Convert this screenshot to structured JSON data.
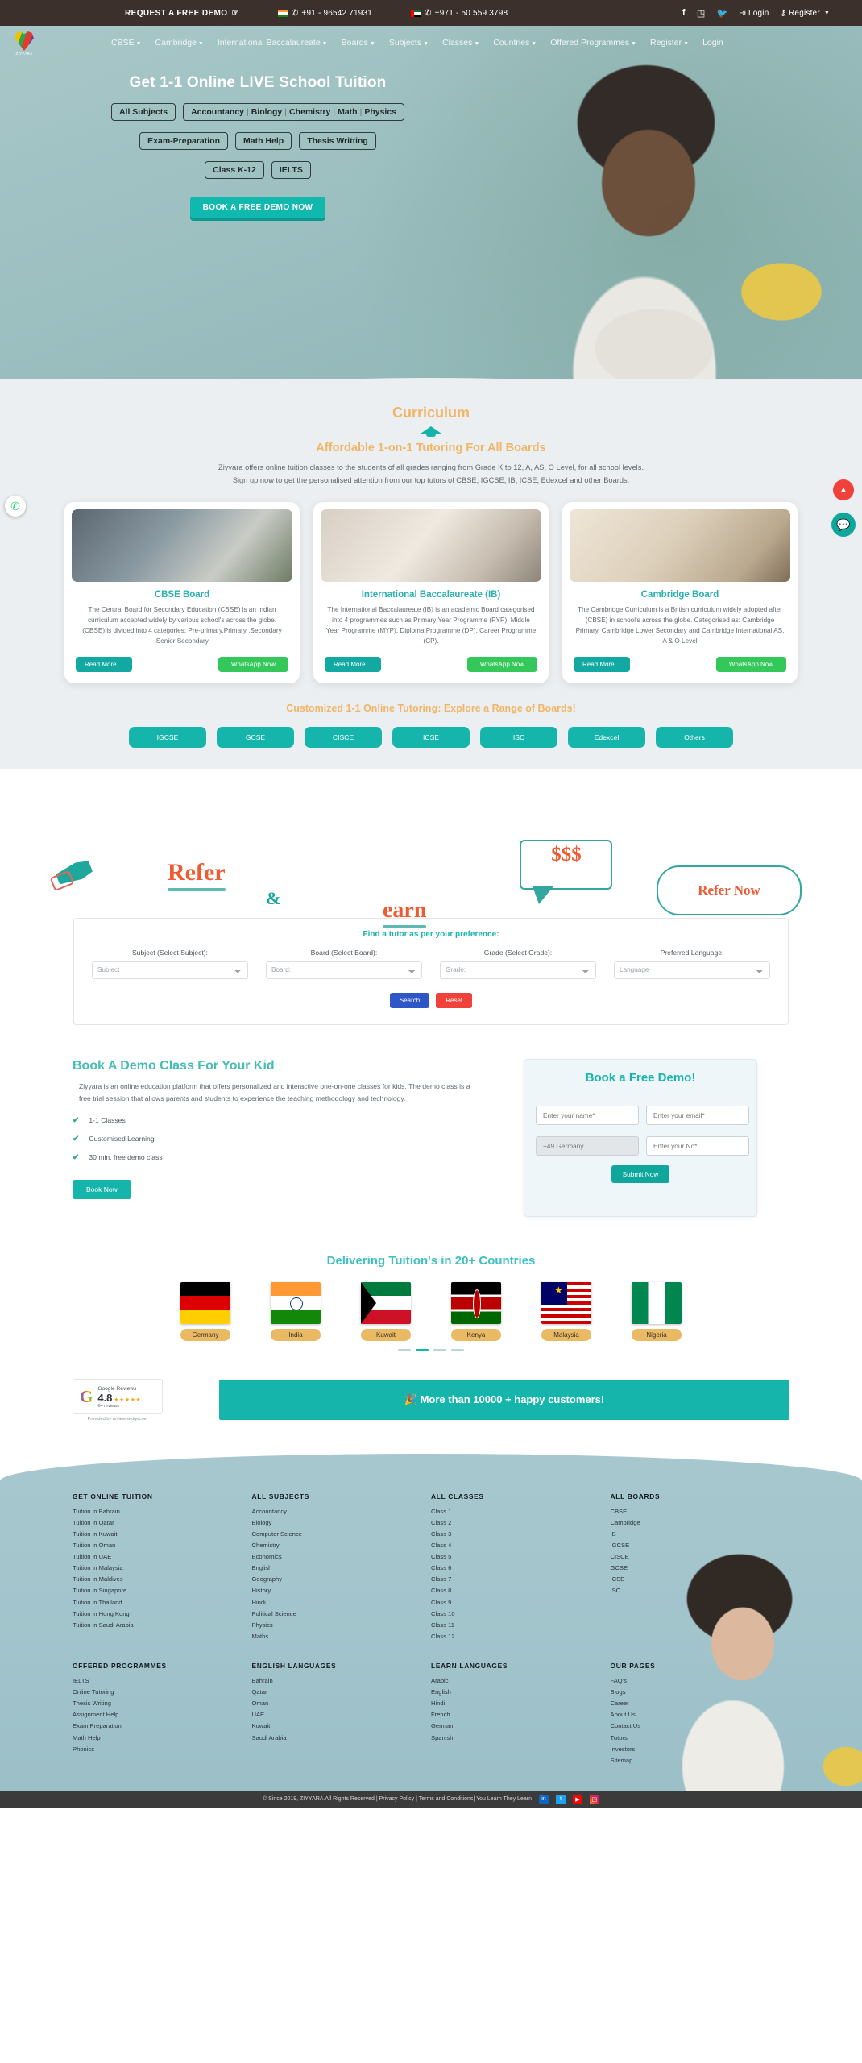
{
  "topbar": {
    "demo_label": "REQUEST A FREE DEMO",
    "phone_in": "+91 - 96542 71931",
    "phone_ae": "+971 - 50 559 3798",
    "login": "Login",
    "register": "Register",
    "icons": [
      "facebook-icon",
      "instagram-icon",
      "twitter-icon"
    ]
  },
  "nav": {
    "brand": "ZIYYARA",
    "items": [
      {
        "label": "CBSE",
        "caret": true
      },
      {
        "label": "Cambridge",
        "caret": true
      },
      {
        "label": "International Baccalaureate",
        "caret": true
      },
      {
        "label": "Boards",
        "caret": true
      },
      {
        "label": "Subjects",
        "caret": true
      },
      {
        "label": "Classes",
        "caret": true
      },
      {
        "label": "Countries",
        "caret": true
      },
      {
        "label": "Offered Programmes",
        "caret": true
      },
      {
        "label": "Register",
        "caret": true
      },
      {
        "label": "Login",
        "caret": false
      }
    ]
  },
  "hero": {
    "title": "Get 1-1 Online LIVE School Tuition",
    "pill_all": "All Subjects",
    "pill_subjects": [
      "Accountancy",
      "Biology",
      "Chemistry",
      "Math",
      "Physics"
    ],
    "pills_row2": [
      "Exam-Preparation",
      "Math Help",
      "Thesis Writting"
    ],
    "pills_row3": [
      "Class K-12",
      "IELTS"
    ],
    "cta": "BOOK A FREE DEMO NOW"
  },
  "curriculum": {
    "title": "Curriculum",
    "subtitle": "Affordable 1-on-1 Tutoring For All Boards",
    "paragraph_line1": "Ziyyara offers online tuition classes to the students of all grades ranging from Grade K to 12, A, AS, O Level, for all school levels.",
    "paragraph_line2": "Sign up now to get the personalised attention from our top tutors of CBSE, IGCSE, IB, ICSE, Edexcel and other Boards.",
    "cards": [
      {
        "title": "CBSE Board",
        "text": "The Central Board for Secondary Education (CBSE) is an Indian curriculum accepted widely by various school's across the globe. (CBSE) is divided into 4 categories: Pre-primary,Primary ,Secondary ,Senior Secondary.",
        "read_more": "Read More....",
        "whatsapp": "WhatsApp Now"
      },
      {
        "title": "International Baccalaureate (IB)",
        "text": "The International Baccalaureate (IB) is an academic Board categorised into 4 programmes such as Primary Year Programme (PYP), Middle Year Programme (MYP), Diploma Programme (DP), Career Programme (CP).",
        "read_more": "Read More....",
        "whatsapp": "WhatsApp Now"
      },
      {
        "title": "Cambridge Board",
        "text": "The Cambridge Curriculum is a British curriculum widely adopted after (CBSE) in school's across the globe. Categorised as: Cambridge Primary, Cambridge Lower Secondary and Cambridge International AS, A & O Level",
        "read_more": "Read More....",
        "whatsapp": "WhatsApp Now"
      }
    ],
    "boards_heading": "Customized 1-1 Online Tutoring: Explore a Range of Boards!",
    "board_buttons": [
      "IGCSE",
      "GCSE",
      "CISCE",
      "ICSE",
      "ISC",
      "Edexcel",
      "Others"
    ]
  },
  "refer": {
    "word1": "Refer",
    "amp": "&",
    "word2": "earn",
    "dollars": "$$$",
    "cta": "Refer Now"
  },
  "find_tutor": {
    "title": "Find a tutor as per your preference:",
    "fields": [
      {
        "label": "Subject (Select Subject):",
        "placeholder": "Subject"
      },
      {
        "label": "Board (Select Board):",
        "placeholder": "Board:"
      },
      {
        "label": "Grade (Select Grade):",
        "placeholder": "Grade:"
      },
      {
        "label": "Preferred Language:",
        "placeholder": "Language"
      }
    ],
    "search": "Search",
    "reset": "Reset"
  },
  "book_demo": {
    "title": "Book A Demo Class For Your Kid",
    "paragraph": "Ziyyara is an online education platform that offers personalized and interactive one-on-one classes for kids. The demo class is a free trial session that allows parents and students to experience the teaching methodology and technology.",
    "checks": [
      "1-1 Classes",
      "Customised Learning",
      "30 min. free demo class"
    ],
    "book_now": "Book Now",
    "card_title": "Book a Free Demo!",
    "name_placeholder": "Enter your name*",
    "email_placeholder": "Enter your email*",
    "country_code": "+49 Germany",
    "phone_placeholder": "Enter your No*",
    "submit": "Submit Now"
  },
  "countries": {
    "title": "Delivering Tuition's in 20+ Countries",
    "items": [
      {
        "name": "Germany",
        "flag": "flag-germany"
      },
      {
        "name": "India",
        "flag": "flag-india"
      },
      {
        "name": "Kuwait",
        "flag": "flag-kuwait"
      },
      {
        "name": "Kenya",
        "flag": "flag-kenya"
      },
      {
        "name": "Malaysia",
        "flag": "flag-malaysia"
      },
      {
        "name": "Nigeria",
        "flag": "flag-nigeria"
      }
    ]
  },
  "reviews": {
    "google_label": "Google Reviews",
    "score": "4.8",
    "stars": "★★★★★",
    "count": "64 reviews",
    "provided_by": "Provided by review-widget.net",
    "happy_customers": "🎉 More than 10000 + happy customers!"
  },
  "footer": {
    "columns_row1": [
      {
        "heading": "GET ONLINE TUITION",
        "links": [
          "Tuition in Bahrain",
          "Tuition in Qatar",
          "Tuition in Kuwait",
          "Tuition in Oman",
          "Tuition in UAE",
          "Tuition in Malaysia",
          "Tuition in Maldives",
          "Tuition in Singapore",
          "Tuition in Thailand",
          "Tuition in Hong Kong",
          "Tuition in Saudi Arabia"
        ]
      },
      {
        "heading": "ALL SUBJECTS",
        "links": [
          "Accountancy",
          "Biology",
          "Computer Science",
          "Chemistry",
          "Economics",
          "English",
          "Geography",
          "History",
          "Hindi",
          "Political Science",
          "Physics",
          "Maths"
        ]
      },
      {
        "heading": "ALL CLASSES",
        "links": [
          "Class 1",
          "Class 2",
          "Class 3",
          "Class 4",
          "Class 5",
          "Class 6",
          "Class 7",
          "Class 8",
          "Class 9",
          "Class 10",
          "Class 11",
          "Class 12"
        ]
      },
      {
        "heading": "ALL BOARDS",
        "links": [
          "CBSE",
          "Cambridge",
          "IB",
          "IGCSE",
          "CISCE",
          "GCSE",
          "ICSE",
          "ISC"
        ]
      }
    ],
    "columns_row2": [
      {
        "heading": "OFFERED PROGRAMMES",
        "links": [
          "IELTS",
          "Online Tutoring",
          "Thesis Writing",
          "Assignment Help",
          "Exam Preparation",
          "Math Help",
          "Phonics"
        ]
      },
      {
        "heading": "ENGLISH LANGUAGES",
        "links": [
          "Bahrain",
          "Qatar",
          "Oman",
          "UAE",
          "Kuwait",
          "Saudi Arabia"
        ]
      },
      {
        "heading": "LEARN LANGUAGES",
        "links": [
          "Arabic",
          "English",
          "Hindi",
          "French",
          "German",
          "Spanish"
        ]
      },
      {
        "heading": "OUR PAGES",
        "links": [
          "FAQ's",
          "Blogs",
          "Career",
          "About Us",
          "Contact Us",
          "Tutors",
          "Investors",
          "Sitemap"
        ]
      }
    ],
    "copyright": "© Since 2019, ZIYYARA.All Rights Reserved | Privacy Policy | Terms and Conditions| You Learn They Learn",
    "social": [
      "linkedin-icon",
      "twitter-icon",
      "youtube-icon",
      "instagram-icon"
    ]
  },
  "floating": {
    "whatsapp": "whatsapp-icon",
    "scroll_top": "arrow-up-icon",
    "chat": "chat-icon"
  },
  "colors": {
    "teal": "#16b5ac",
    "orange_heading": "#f0b566",
    "green": "#34c759",
    "red": "#f0413b",
    "blue": "#2f56c7",
    "topbar_bg": "#3b302c"
  }
}
